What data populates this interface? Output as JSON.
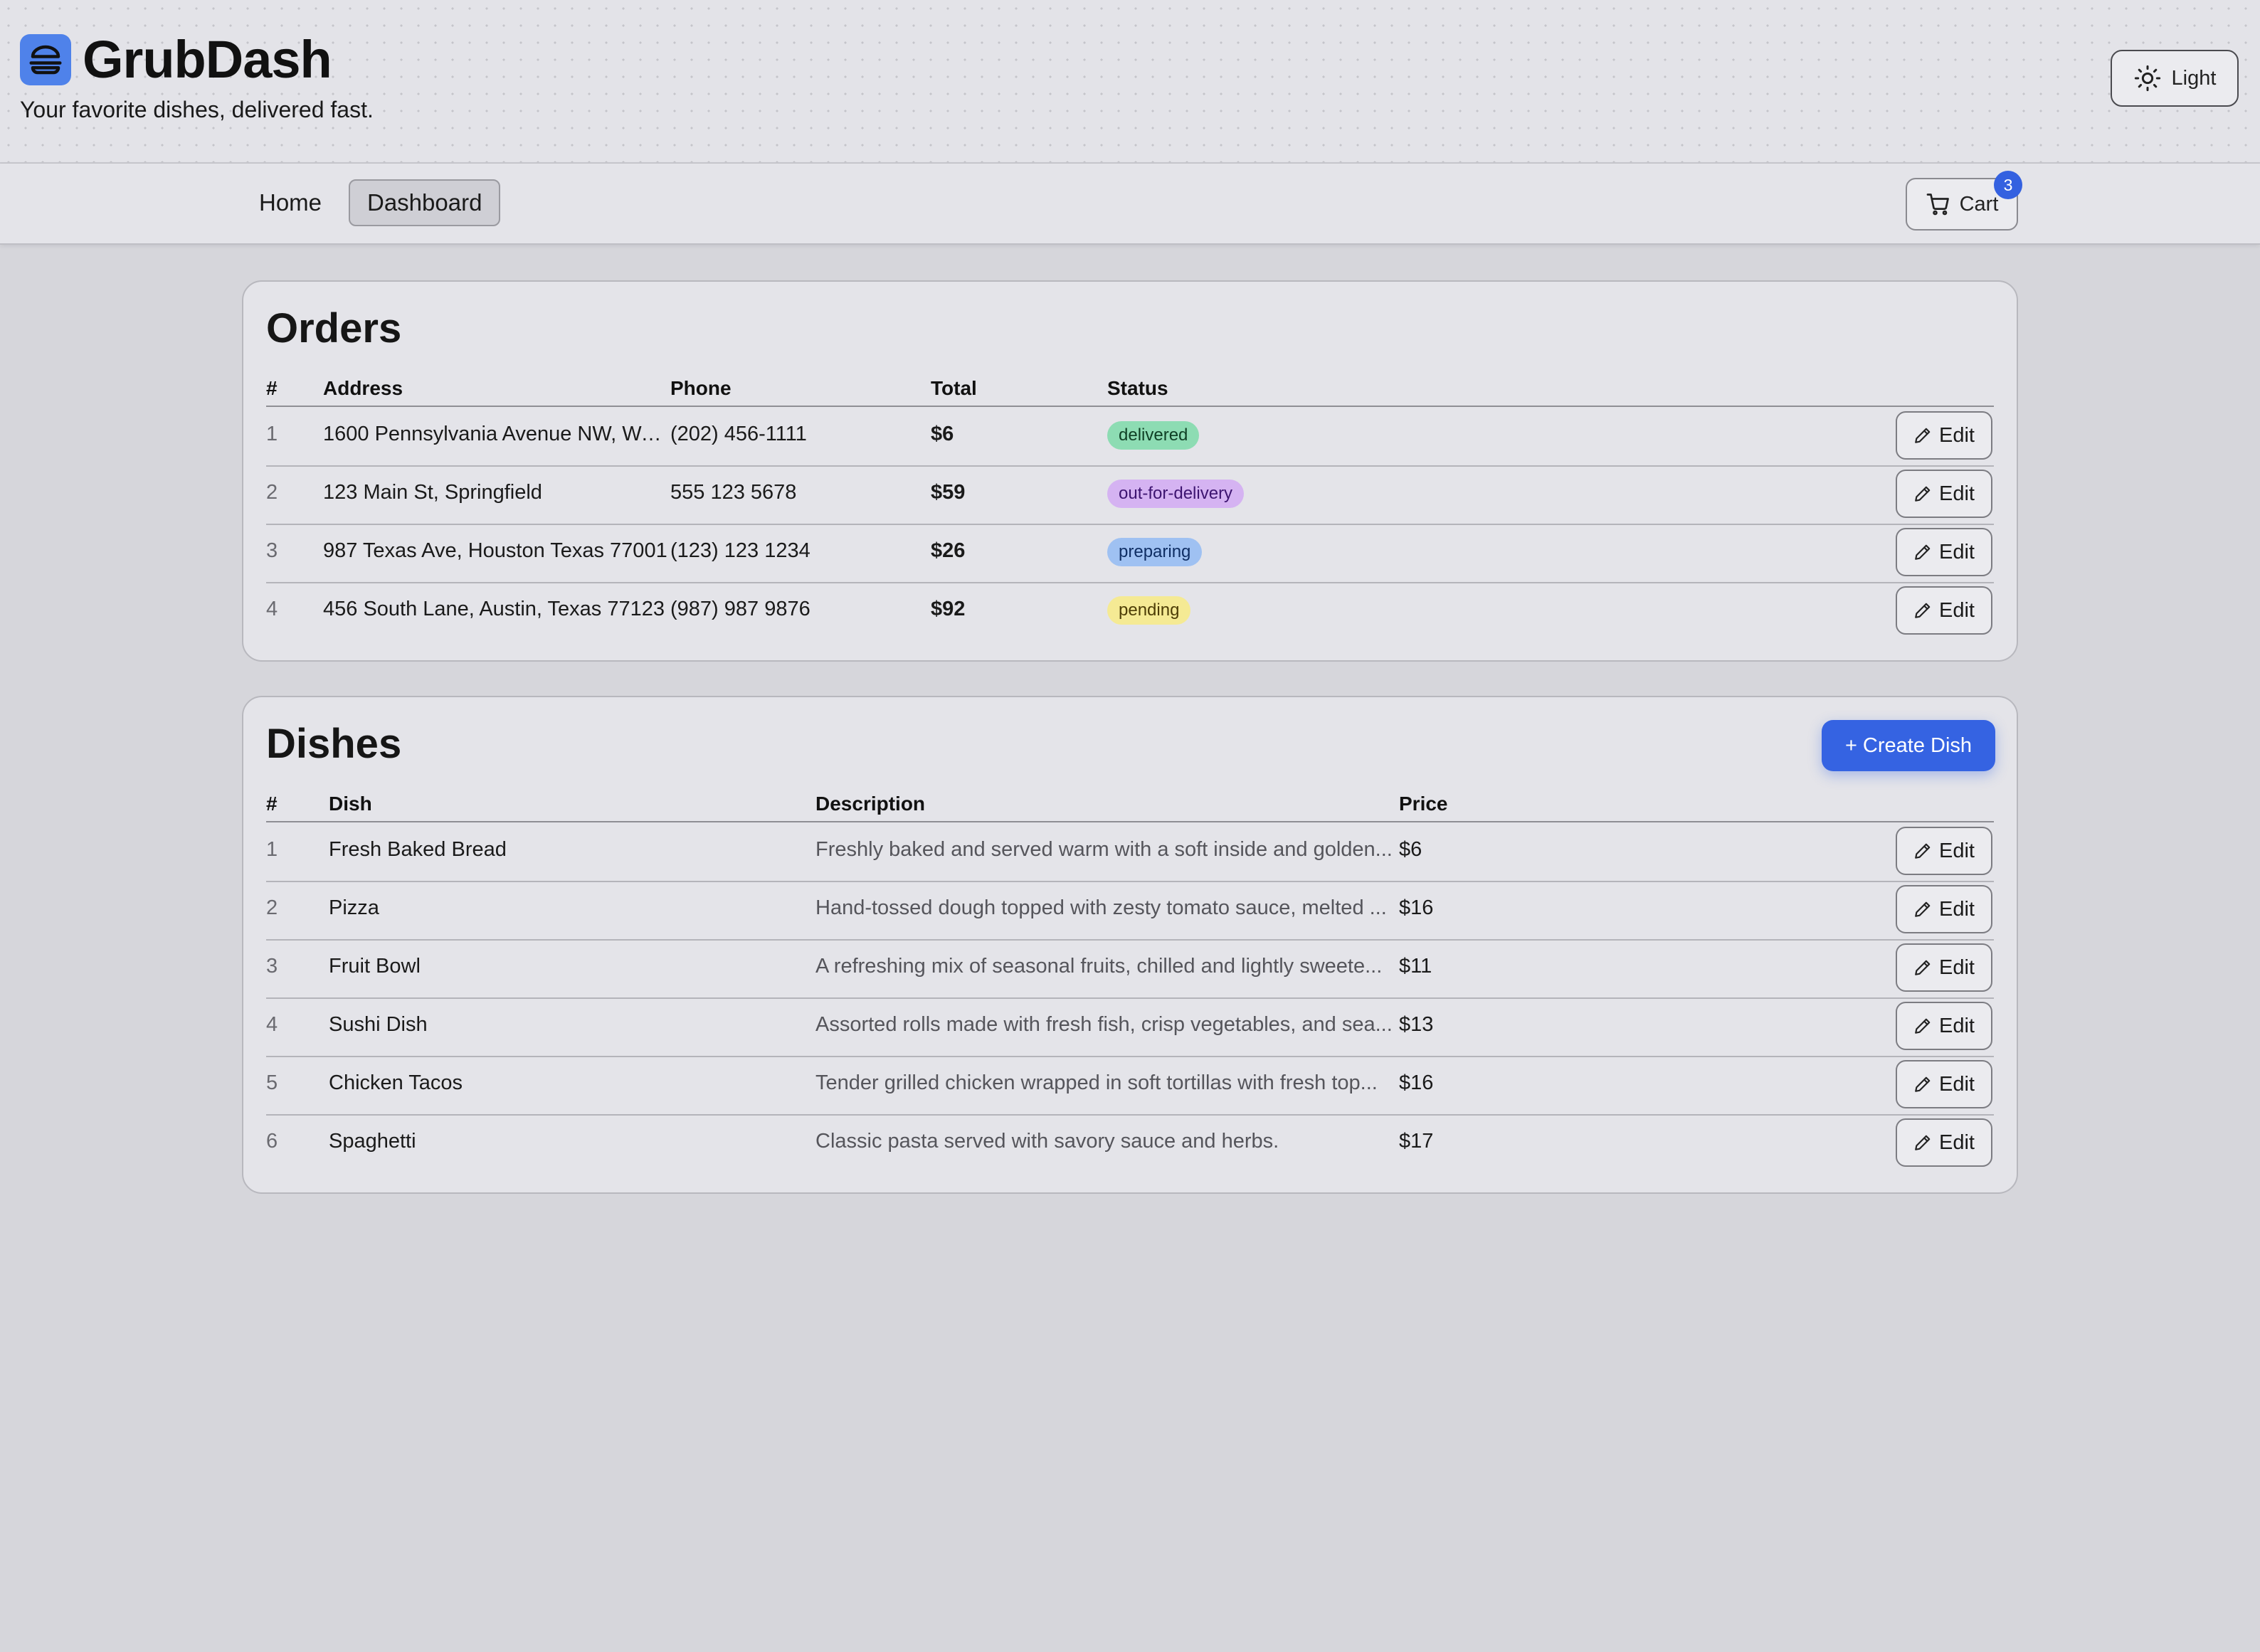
{
  "header": {
    "title": "GrubDash",
    "tagline": "Your favorite dishes, delivered fast.",
    "theme_label": "Light"
  },
  "nav": {
    "home_label": "Home",
    "dashboard_label": "Dashboard",
    "cart_label": "Cart",
    "cart_count": "3"
  },
  "orders": {
    "title": "Orders",
    "columns": [
      "#",
      "Address",
      "Phone",
      "Total",
      "Status"
    ],
    "rows": [
      {
        "num": "1",
        "address": "1600 Pennsylvania Avenue NW, Wa...",
        "phone": "(202) 456-1111",
        "total": "$6",
        "status": "delivered",
        "edit": "Edit"
      },
      {
        "num": "2",
        "address": "123 Main St, Springfield",
        "phone": "555 123 5678",
        "total": "$59",
        "status": "out-for-delivery",
        "edit": "Edit"
      },
      {
        "num": "3",
        "address": "987 Texas Ave, Houston Texas 77001",
        "phone": "(123) 123 1234",
        "total": "$26",
        "status": "preparing",
        "edit": "Edit"
      },
      {
        "num": "4",
        "address": "456 South Lane, Austin, Texas 77123",
        "phone": "(987) 987 9876",
        "total": "$92",
        "status": "pending",
        "edit": "Edit"
      }
    ]
  },
  "dishes": {
    "title": "Dishes",
    "create_label": "+ Create Dish",
    "columns": [
      "#",
      "Dish",
      "Description",
      "Price"
    ],
    "rows": [
      {
        "num": "1",
        "name": "Fresh Baked Bread",
        "description": "Freshly baked and served warm with a soft inside and golden...",
        "price": "$6",
        "edit": "Edit"
      },
      {
        "num": "2",
        "name": "Pizza",
        "description": "Hand-tossed dough topped with zesty tomato sauce, melted ...",
        "price": "$16",
        "edit": "Edit"
      },
      {
        "num": "3",
        "name": "Fruit Bowl",
        "description": "A refreshing mix of seasonal fruits, chilled and lightly sweete...",
        "price": "$11",
        "edit": "Edit"
      },
      {
        "num": "4",
        "name": "Sushi Dish",
        "description": "Assorted rolls made with fresh fish, crisp vegetables, and sea...",
        "price": "$13",
        "edit": "Edit"
      },
      {
        "num": "5",
        "name": "Chicken Tacos",
        "description": "Tender grilled chicken wrapped in soft tortillas with fresh top...",
        "price": "$16",
        "edit": "Edit"
      },
      {
        "num": "6",
        "name": "Spaghetti",
        "description": "Classic pasta served with savory sauce and herbs.",
        "price": "$17",
        "edit": "Edit"
      }
    ]
  },
  "colors": {
    "accent": "#3563e2",
    "logo_bg": "#4f82ea",
    "status_delivered": "#8ddcb3",
    "status_out_for_delivery": "#d5b3f2",
    "status_preparing": "#9fc1f2",
    "status_pending": "#f5ea94"
  },
  "icons": {
    "logo": "burger-icon",
    "theme": "sun-icon",
    "cart": "cart-icon",
    "edit": "pencil-icon"
  }
}
